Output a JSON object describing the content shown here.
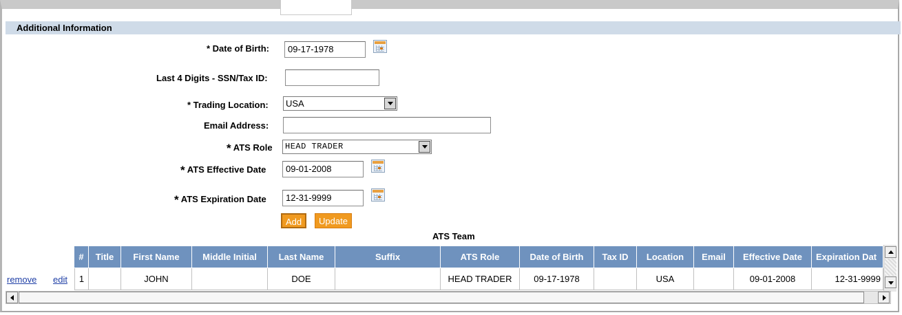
{
  "section": {
    "title": "Additional Information"
  },
  "form": {
    "dob_label": "* Date of Birth:",
    "dob_value": "09-17-1978",
    "ssn_label": "Last 4 Digits - SSN/Tax ID:",
    "ssn_value": "",
    "trading_label": "* Trading Location:",
    "trading_value": "USA",
    "email_label": "Email Address:",
    "email_value": "",
    "ats_role_label": "ATS Role",
    "ats_role_value": "HEAD TRADER",
    "ats_effective_label": "ATS Effective Date",
    "ats_effective_value": "09-01-2008",
    "ats_expiration_label": "ATS Expiration Date",
    "ats_expiration_value": "12-31-9999",
    "star": "*"
  },
  "buttons": {
    "add": "Add",
    "update": "Update"
  },
  "team": {
    "title": "ATS Team",
    "columns": [
      "#",
      "Title",
      "First Name",
      "Middle Initial",
      "Last Name",
      "Suffix",
      "ATS Role",
      "Date of Birth",
      "Tax ID",
      "Location",
      "Email",
      "Effective Date",
      "Expiration Dat"
    ],
    "rows": [
      {
        "num": "1",
        "title": "",
        "first": "JOHN",
        "middle": "",
        "last": "DOE",
        "suffix": "",
        "role": "HEAD TRADER",
        "dob": "09-17-1978",
        "taxid": "",
        "location": "USA",
        "email": "",
        "effective": "09-01-2008",
        "expiration": "12-31-9999"
      }
    ],
    "row_actions": {
      "remove": "remove",
      "edit": "edit"
    }
  },
  "colors": {
    "header_bg": "#6f92be",
    "section_bg": "#cfdbe8",
    "button_bg": "#f09a20",
    "link": "#1f3fa6"
  }
}
